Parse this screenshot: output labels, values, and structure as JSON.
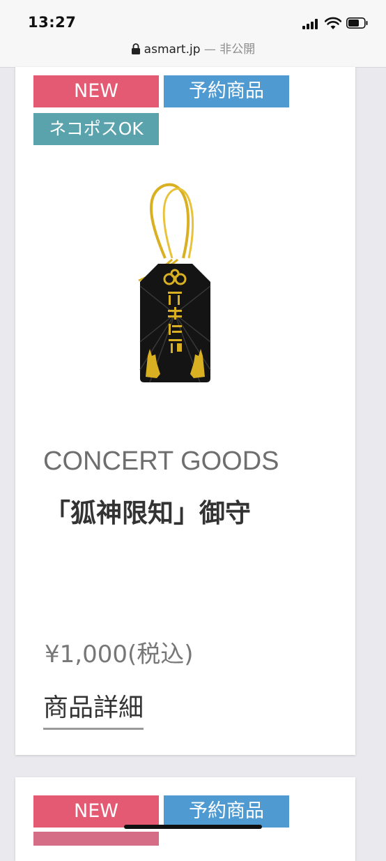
{
  "status_bar": {
    "time": "13:27"
  },
  "browser": {
    "url": "asmart.jp",
    "url_suffix": " — 非公開"
  },
  "product": {
    "tags": {
      "new": "NEW",
      "preorder": "予約商品",
      "nekopos": "ネコポスOK"
    },
    "image_icon": "omamori-charm",
    "category": "CONCERT GOODS",
    "name": "「狐神限知」御守",
    "price": "¥1,000(税込)",
    "details_link": "商品詳細"
  },
  "next_product": {
    "tags": {
      "new": "NEW",
      "preorder": "予約商品"
    }
  },
  "colors": {
    "tag_new": "#e35a72",
    "tag_preorder": "#4f9bd1",
    "tag_nekopos": "#5aa3ad",
    "charm_gold": "#d9b021",
    "charm_black": "#141414"
  }
}
